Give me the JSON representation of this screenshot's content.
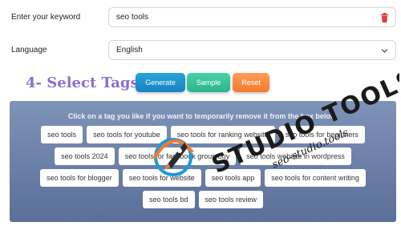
{
  "form": {
    "keyword_label": "Enter your keyword",
    "keyword_value": "seo tools",
    "language_label": "Language",
    "language_value": "English"
  },
  "section": {
    "title": "4- Select Tags"
  },
  "buttons": {
    "generate": "Generate",
    "sample": "Sample",
    "reset": "Reset"
  },
  "tags_panel": {
    "hint": "Click on a tag you like if you want to temporarily remove it from the box below.",
    "tags": [
      "seo tools",
      "seo tools for youtube",
      "seo tools for ranking website",
      "seo tools for beginners",
      "seo tools 2024",
      "seo tools for facebook group buy",
      "seo tools website in wordpress",
      "seo tools for blogger",
      "seo tools for website",
      "seo tools app",
      "seo tools for content writing",
      "seo tools bd",
      "seo tools review"
    ]
  },
  "watermark": {
    "brand": "STUDIO TOOLS",
    "domain": "seo-studio.tools"
  },
  "colors": {
    "section_title": "#8a6fcf",
    "generate": "#1f93cf",
    "sample": "#3cc79d",
    "reset": "#f88a40",
    "panel": "#6c80a8",
    "trash": "#e53935"
  },
  "icons": {
    "delete": "trash-icon",
    "dropdown": "chevron-down-icon"
  }
}
